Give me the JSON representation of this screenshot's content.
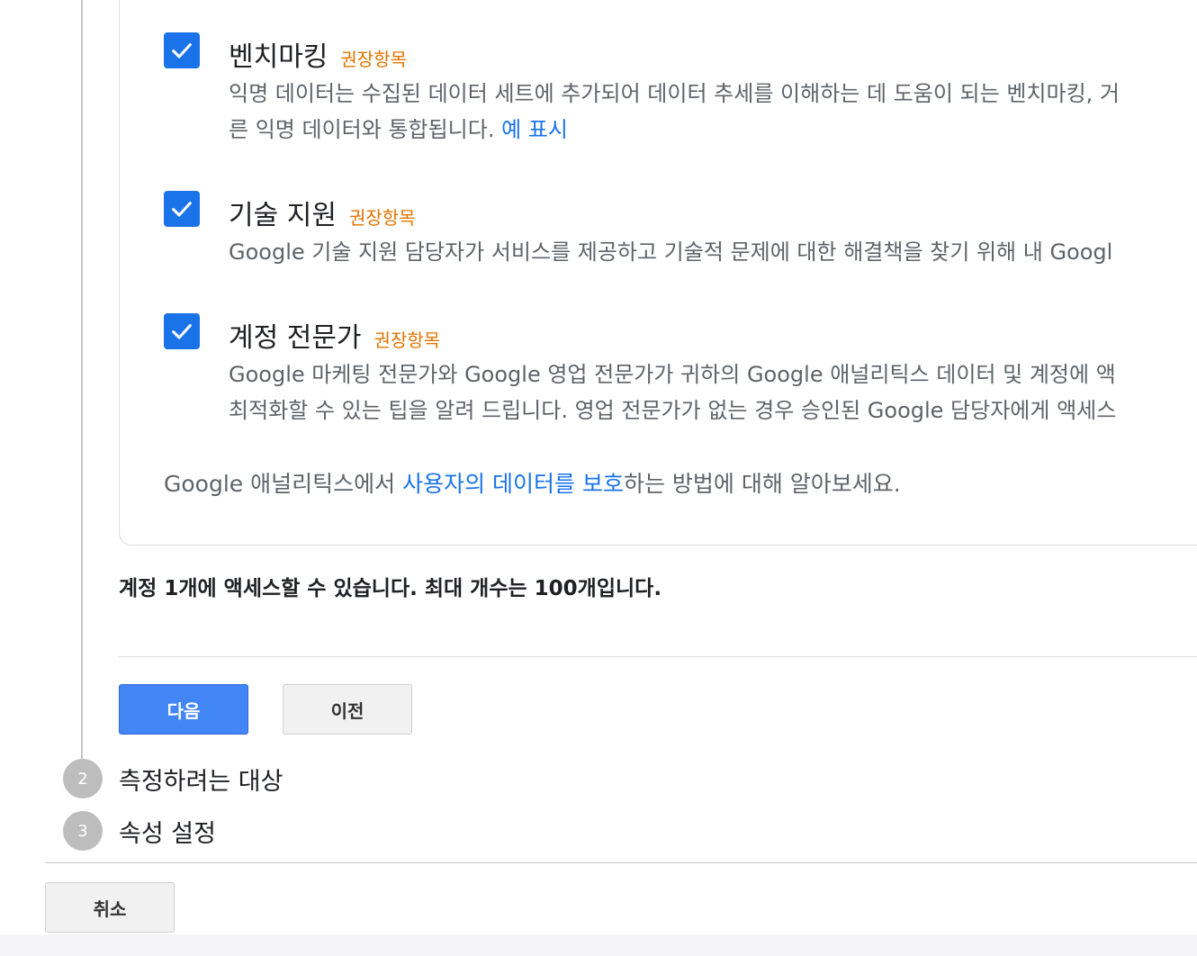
{
  "options": [
    {
      "title": "벤치마킹",
      "badge": "권장항목",
      "desc_line1": "익명 데이터는 수집된 데이터 세트에 추가되어 데이터 추세를 이해하는 데 도움이 되는 벤치마킹, 거",
      "desc_line2": "른 익명 데이터와 통합됩니다.",
      "link": "예 표시",
      "checked": true
    },
    {
      "title": "기술 지원",
      "badge": "권장항목",
      "desc_line1": "Google 기술 지원 담당자가 서비스를 제공하고 기술적 문제에 대한 해결책을 찾기 위해 내 Googl",
      "checked": true
    },
    {
      "title": "계정 전문가",
      "badge": "권장항목",
      "desc_line1": "Google 마케팅 전문가와 Google 영업 전문가가 귀하의 Google 애널리틱스 데이터 및 계정에 액",
      "desc_line2": "최적화할 수 있는 팁을 알려 드립니다. 영업 전문가가 없는 경우 승인된 Google 담당자에게 액세스",
      "checked": true
    }
  ],
  "privacy": {
    "prefix": "Google 애널리틱스에서 ",
    "link": "사용자의 데이터를 보호",
    "suffix": "하는 방법에 대해 알아보세요."
  },
  "access_note": "계정 1개에 액세스할 수 있습니다. 최대 개수는 100개입니다.",
  "buttons": {
    "next": "다음",
    "prev": "이전",
    "cancel": "취소"
  },
  "steps": [
    {
      "number": "2",
      "label": "측정하려는 대상"
    },
    {
      "number": "3",
      "label": "속성 설정"
    }
  ],
  "colors": {
    "primary": "#4285f4",
    "checkbox": "#1a73e8",
    "badge": "#e37400",
    "link": "#1a73e8"
  }
}
